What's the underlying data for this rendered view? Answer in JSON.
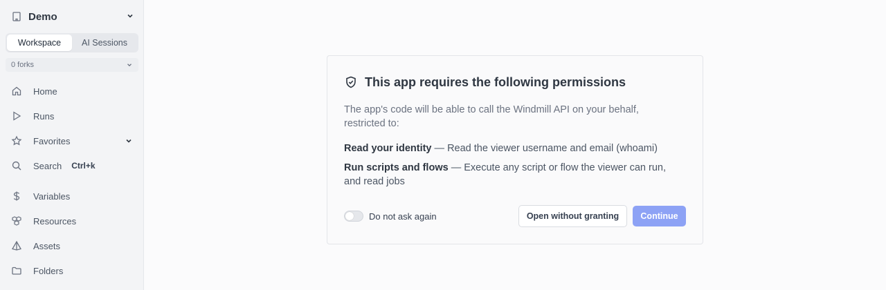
{
  "sidebar": {
    "workspace_name": "Demo",
    "tabs": [
      {
        "label": "Workspace",
        "active": true
      },
      {
        "label": "AI Sessions",
        "active": false
      }
    ],
    "forks_label": "0 forks",
    "items": [
      {
        "label": "Home",
        "icon": "home-icon"
      },
      {
        "label": "Runs",
        "icon": "play-icon"
      },
      {
        "label": "Favorites",
        "icon": "star-icon"
      },
      {
        "label": "Search",
        "icon": "search-icon",
        "shortcut": "Ctrl+k"
      },
      {
        "label": "Variables",
        "icon": "dollar-icon"
      },
      {
        "label": "Resources",
        "icon": "boxes-icon"
      },
      {
        "label": "Assets",
        "icon": "pyramid-icon"
      },
      {
        "label": "Folders",
        "icon": "folder-icon"
      }
    ]
  },
  "dialog": {
    "title": "This app requires the following permissions",
    "description": "The app's code will be able to call the Windmill API on your behalf, restricted to:",
    "permissions": [
      {
        "name": "Read your identity",
        "separator": " — ",
        "detail": "Read the viewer username and email (whoami)"
      },
      {
        "name": "Run scripts and flows",
        "separator": " — ",
        "detail": "Execute any script or flow the viewer can run, and read jobs"
      }
    ],
    "toggle_label": "Do not ask again",
    "toggle_on": false,
    "secondary_button": "Open without granting",
    "primary_button": "Continue"
  },
  "colors": {
    "accent": "#8da2f5",
    "sidebar_bg": "#f3f4f6",
    "page_bg": "#fbfbfc"
  }
}
